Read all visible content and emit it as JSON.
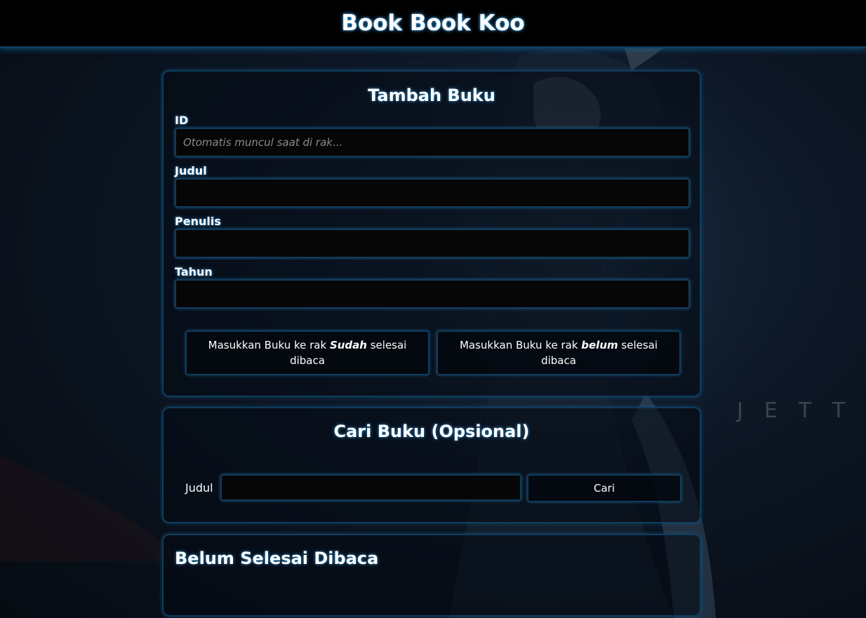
{
  "header": {
    "title": "Book Book Koo"
  },
  "background": {
    "watermark": "JETT"
  },
  "add_form": {
    "title": "Tambah Buku",
    "id_label": "ID",
    "id_placeholder": "Otomatis muncul saat di rak...",
    "title_label": "Judul",
    "title_value": "",
    "author_label": "Penulis",
    "author_value": "",
    "year_label": "Tahun",
    "year_value": "",
    "btn_done": {
      "prefix": "Masukkan Buku ke rak ",
      "emphasis": "Sudah",
      "suffix": " selesai dibaca"
    },
    "btn_undone": {
      "prefix": "Masukkan Buku ke rak ",
      "emphasis": "belum",
      "suffix": " selesai dibaca"
    }
  },
  "search": {
    "title": "Cari Buku (Opsional)",
    "label": "Judul",
    "value": "",
    "button_label": "Cari"
  },
  "unread_shelf": {
    "title": "Belum Selesai Dibaca"
  },
  "colors": {
    "accent_glow": "#2e8fd0",
    "border": "#0f3d5c",
    "input_bg": "#060606",
    "header_bg": "#000000"
  }
}
